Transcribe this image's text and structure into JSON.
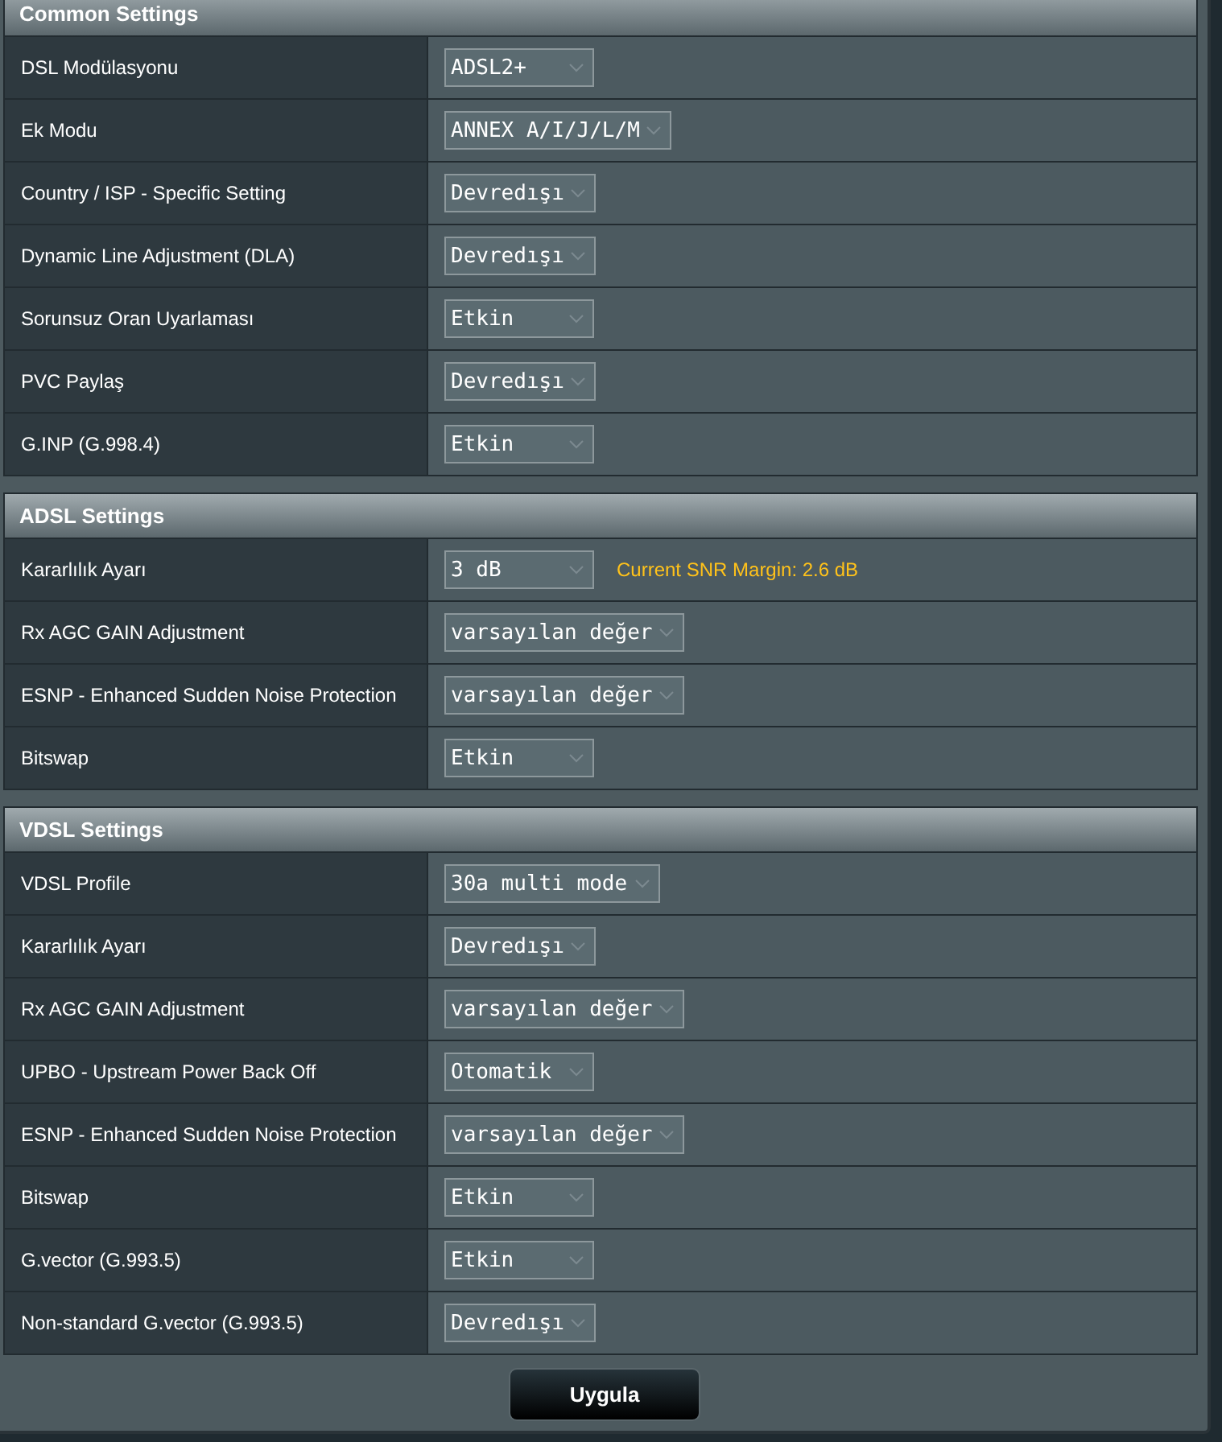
{
  "sections": [
    {
      "title": "Common Settings",
      "rows": [
        {
          "label": "DSL Modülasyonu",
          "value": "ADSL2+"
        },
        {
          "label": "Ek Modu",
          "value": "ANNEX A/I/J/L/M"
        },
        {
          "label": "Country / ISP - Specific Setting",
          "value": "Devredışı"
        },
        {
          "label": "Dynamic Line Adjustment (DLA)",
          "value": "Devredışı"
        },
        {
          "label": "Sorunsuz Oran Uyarlaması",
          "value": "Etkin"
        },
        {
          "label": "PVC Paylaş",
          "value": "Devredışı"
        },
        {
          "label": "G.INP (G.998.4)",
          "value": "Etkin"
        }
      ]
    },
    {
      "title": "ADSL Settings",
      "rows": [
        {
          "label": "Kararlılık Ayarı",
          "value": "3 dB",
          "note": "Current SNR Margin: 2.6 dB"
        },
        {
          "label": "Rx AGC GAIN Adjustment",
          "value": "varsayılan değer"
        },
        {
          "label": "ESNP - Enhanced Sudden Noise Protection",
          "value": "varsayılan değer"
        },
        {
          "label": "Bitswap",
          "value": "Etkin"
        }
      ]
    },
    {
      "title": "VDSL Settings",
      "rows": [
        {
          "label": "VDSL Profile",
          "value": "30a multi mode"
        },
        {
          "label": "Kararlılık Ayarı",
          "value": "Devredışı"
        },
        {
          "label": "Rx AGC GAIN Adjustment",
          "value": "varsayılan değer"
        },
        {
          "label": "UPBO - Upstream Power Back Off",
          "value": "Otomatik"
        },
        {
          "label": "ESNP - Enhanced Sudden Noise Protection",
          "value": "varsayılan değer"
        },
        {
          "label": "Bitswap",
          "value": "Etkin"
        },
        {
          "label": "G.vector (G.993.5)",
          "value": "Etkin"
        },
        {
          "label": "Non-standard G.vector (G.993.5)",
          "value": "Devredışı"
        }
      ]
    }
  ],
  "apply_button": "Uygula"
}
